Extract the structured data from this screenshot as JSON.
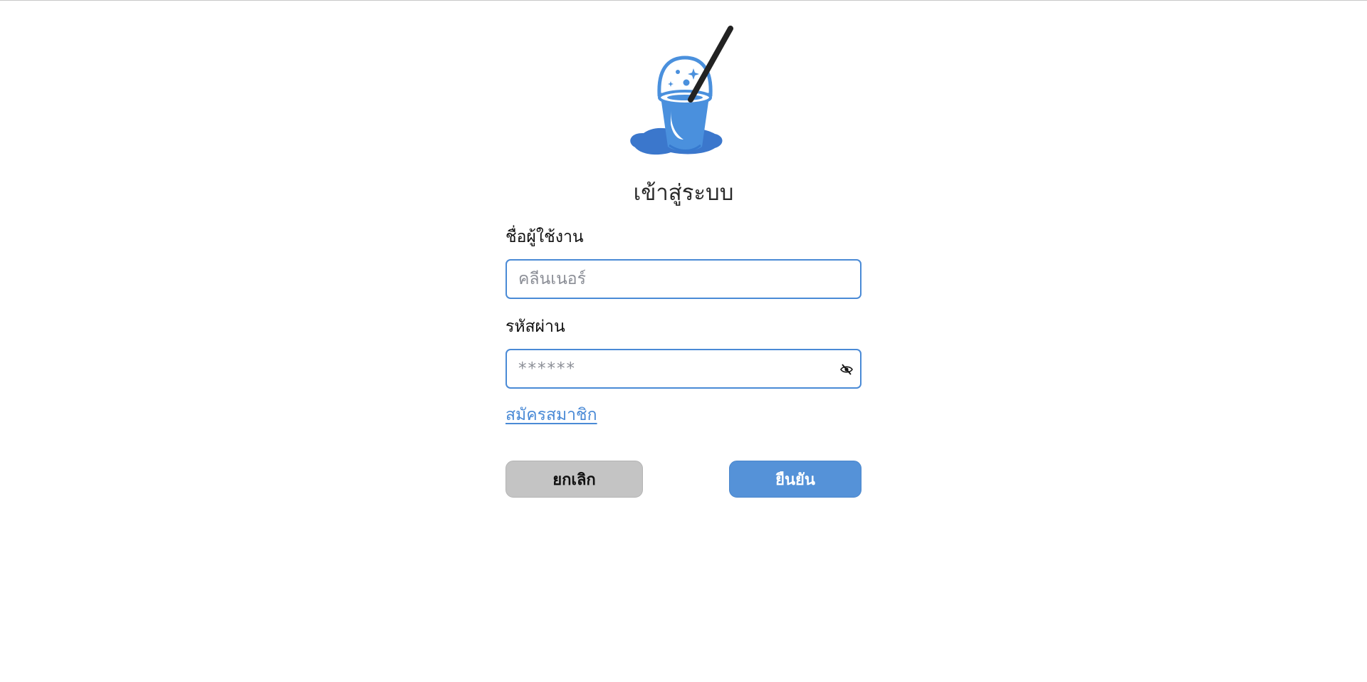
{
  "login": {
    "title": "เข้าสู่ระบบ",
    "username_label": "ชื่อผู้ใช้งาน",
    "username_placeholder": "คลีนเนอร์",
    "username_value": "",
    "password_label": "รหัสผ่าน",
    "password_placeholder": "******",
    "password_value": "",
    "register_link": "สมัครสมาชิก",
    "cancel_label": "ยกเลิก",
    "confirm_label": "ยืนยัน"
  },
  "icons": {
    "logo": "bucket-logo-icon",
    "password_toggle": "eye-slash-icon"
  },
  "colors": {
    "accent": "#4a8ad6",
    "confirm_button": "#5592d8",
    "cancel_button": "#c4c4c4",
    "logo_blue": "#4a90dd",
    "logo_dark": "#222222"
  }
}
